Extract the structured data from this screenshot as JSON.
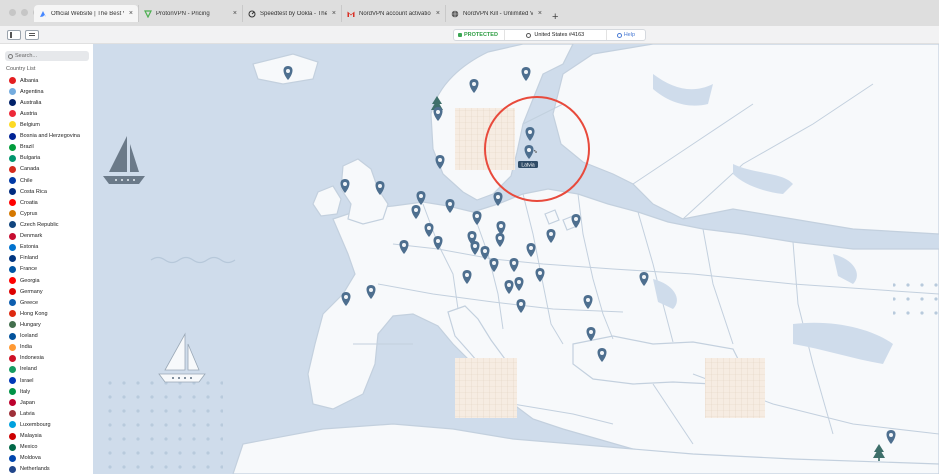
{
  "browser": {
    "tabs": [
      {
        "title": "Official Website | The Best VPN",
        "icon": "nordvpn-favicon",
        "active": true
      },
      {
        "title": "ProtonVPN - Pricing",
        "icon": "protonvpn-favicon",
        "active": false
      },
      {
        "title": "Speedtest by Ookla - The Global",
        "icon": "speedtest-favicon",
        "active": false
      },
      {
        "title": "NordVPN account activation -",
        "icon": "gmail-favicon",
        "active": false
      },
      {
        "title": "NordVPN Kill - Unlimited VPN",
        "icon": "globe-favicon",
        "active": false
      }
    ],
    "new_tab": "+"
  },
  "toolbar": {
    "status": "PROTECTED",
    "server": "United States #4163",
    "help": "Help",
    "status_color": "#3aa653",
    "accent": "#4a7bd4"
  },
  "sidebar": {
    "search_placeholder": "Search...",
    "list_label": "Country List",
    "countries": [
      {
        "name": "Albania",
        "flag": "#e41e20"
      },
      {
        "name": "Argentina",
        "flag": "#74acdf"
      },
      {
        "name": "Australia",
        "flag": "#012169"
      },
      {
        "name": "Austria",
        "flag": "#ed2939"
      },
      {
        "name": "Belgium",
        "flag": "#fdda24"
      },
      {
        "name": "Bosnia and Herzegovina",
        "flag": "#002395"
      },
      {
        "name": "Brazil",
        "flag": "#009c3b"
      },
      {
        "name": "Bulgaria",
        "flag": "#00966e"
      },
      {
        "name": "Canada",
        "flag": "#d52b1e"
      },
      {
        "name": "Chile",
        "flag": "#0039a6"
      },
      {
        "name": "Costa Rica",
        "flag": "#002b7f"
      },
      {
        "name": "Croatia",
        "flag": "#ff0000"
      },
      {
        "name": "Cyprus",
        "flag": "#d57800"
      },
      {
        "name": "Czech Republic",
        "flag": "#11457e"
      },
      {
        "name": "Denmark",
        "flag": "#c60c30"
      },
      {
        "name": "Estonia",
        "flag": "#0072ce"
      },
      {
        "name": "Finland",
        "flag": "#003580"
      },
      {
        "name": "France",
        "flag": "#0055a4"
      },
      {
        "name": "Georgia",
        "flag": "#ff0000"
      },
      {
        "name": "Germany",
        "flag": "#dd0000"
      },
      {
        "name": "Greece",
        "flag": "#0d5eaf"
      },
      {
        "name": "Hong Kong",
        "flag": "#de2910"
      },
      {
        "name": "Hungary",
        "flag": "#436f4d"
      },
      {
        "name": "Iceland",
        "flag": "#02529c"
      },
      {
        "name": "India",
        "flag": "#ff9933"
      },
      {
        "name": "Indonesia",
        "flag": "#ce1126"
      },
      {
        "name": "Ireland",
        "flag": "#169b62"
      },
      {
        "name": "Israel",
        "flag": "#0038b8"
      },
      {
        "name": "Italy",
        "flag": "#009246"
      },
      {
        "name": "Japan",
        "flag": "#bc002d"
      },
      {
        "name": "Latvia",
        "flag": "#9e3039"
      },
      {
        "name": "Luxembourg",
        "flag": "#00a1de"
      },
      {
        "name": "Malaysia",
        "flag": "#cc0001"
      },
      {
        "name": "Mexico",
        "flag": "#006847"
      },
      {
        "name": "Moldova",
        "flag": "#0046ae"
      },
      {
        "name": "Netherlands",
        "flag": "#21468b"
      }
    ]
  },
  "map": {
    "ocean_color": "#cfdceb",
    "land_color": "#f7f9fb",
    "border_color": "#c3d0de",
    "pin_color": "#4e6f8f",
    "highlight_color": "#e84a3c",
    "hover_tooltip": "Latvia"
  }
}
